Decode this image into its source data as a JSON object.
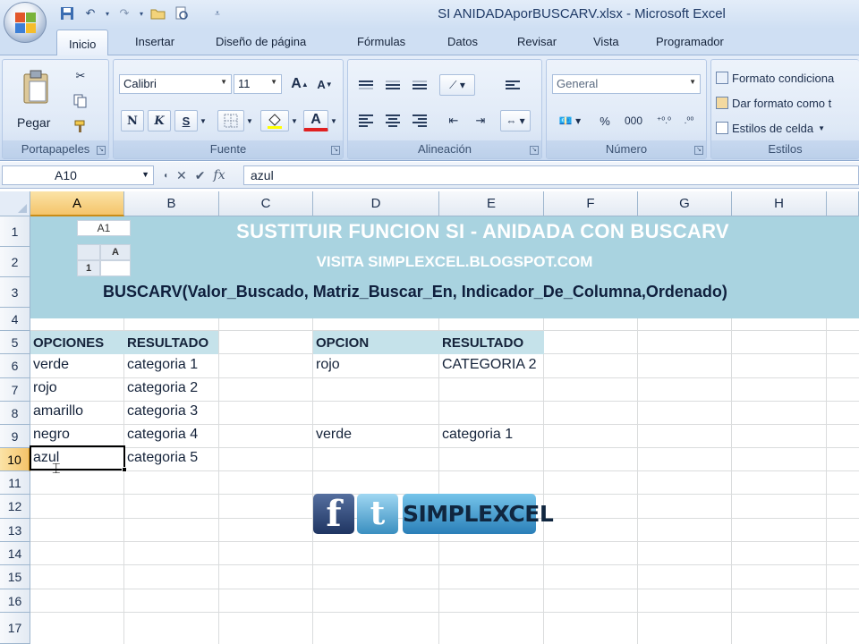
{
  "window": {
    "title": "SI ANIDADAporBUSCARV.xlsx - Microsoft Excel"
  },
  "ribbon": {
    "tabs": [
      "Inicio",
      "Insertar",
      "Diseño de página",
      "Fórmulas",
      "Datos",
      "Revisar",
      "Vista",
      "Programador"
    ],
    "active_tab": "Inicio",
    "clipboard": {
      "paste_label": "Pegar",
      "group_label": "Portapapeles"
    },
    "font": {
      "name": "Calibri",
      "size": "11",
      "bold": "N",
      "italic": "K",
      "underline": "S",
      "grow": "A",
      "shrink": "A",
      "color_letter": "A",
      "group_label": "Fuente"
    },
    "alignment": {
      "group_label": "Alineación"
    },
    "number": {
      "format": "General",
      "percent": "%",
      "thousands": "000",
      "group_label": "Número"
    },
    "styles": {
      "conditional": "Formato condiciona",
      "as_table": "Dar formato como t",
      "cell_styles": "Estilos de celda",
      "group_label": "Estilos"
    }
  },
  "formula_bar": {
    "name_box": "A10",
    "fx": "fx",
    "value": "azul"
  },
  "grid": {
    "columns": [
      "A",
      "B",
      "C",
      "D",
      "E",
      "F",
      "G",
      "H"
    ],
    "selected_column": "A",
    "rows": [
      "1",
      "2",
      "3",
      "4",
      "5",
      "6",
      "7",
      "8",
      "9",
      "10",
      "11",
      "12",
      "13",
      "14",
      "15",
      "16",
      "17"
    ],
    "selected_row": "10"
  },
  "banner": {
    "title": "SUSTITUIR FUNCION SI - ANIDADA CON BUSCARV",
    "subtitle": "VISITA SIMPLEXCEL.BLOGSPOT.COM",
    "syntax": "BUSCARV(Valor_Buscado, Matriz_Buscar_En, Indicador_De_Columna,Ordenado)"
  },
  "mini_sheet": {
    "name": "A1",
    "col": "A",
    "row": "1"
  },
  "table_left": {
    "headers": [
      "OPCIONES",
      "RESULTADO"
    ],
    "rows": [
      [
        "verde",
        "categoria 1"
      ],
      [
        "rojo",
        "categoria 2"
      ],
      [
        "amarillo",
        "categoria 3"
      ],
      [
        "negro",
        "categoria 4"
      ],
      [
        "azul",
        "categoria 5"
      ]
    ]
  },
  "table_right": {
    "headers": [
      "OPCION",
      "RESULTADO"
    ],
    "rows": [
      [
        "rojo",
        "CATEGORIA 2"
      ],
      [
        "verde",
        "categoria 1"
      ]
    ]
  },
  "social": {
    "facebook": "f",
    "twitter": "t",
    "brand": "SIMPLEXCEL"
  },
  "colors": {
    "banner": "#a9d3e0",
    "table_header": "#c5e2ea",
    "selection": "#f4c46a"
  }
}
